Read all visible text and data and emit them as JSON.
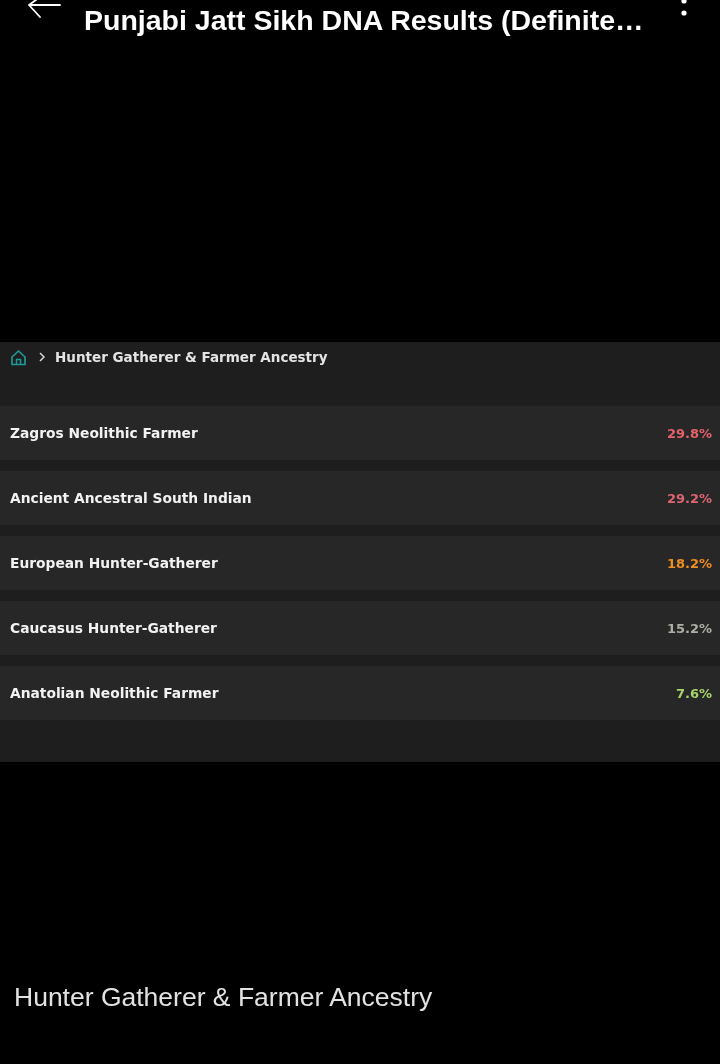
{
  "top_bar": {
    "title": "Punjabi Jatt Sikh DNA Results (Definite…"
  },
  "breadcrumb": {
    "label": "Hunter Gatherer & Farmer Ancestry"
  },
  "rows": [
    {
      "name": "Zagros Neolithic Farmer",
      "percent": "29.8%",
      "color": "#e6626a"
    },
    {
      "name": "Ancient Ancestral South Indian",
      "percent": "29.2%",
      "color": "#dc6571"
    },
    {
      "name": "European Hunter-Gatherer",
      "percent": "18.2%",
      "color": "#ee8e20"
    },
    {
      "name": "Caucasus Hunter-Gatherer",
      "percent": "15.2%",
      "color": "#aeaea6"
    },
    {
      "name": "Anatolian Neolithic Farmer",
      "percent": "7.6%",
      "color": "#a6d46c"
    }
  ],
  "caption": "Hunter Gatherer & Farmer Ancestry"
}
